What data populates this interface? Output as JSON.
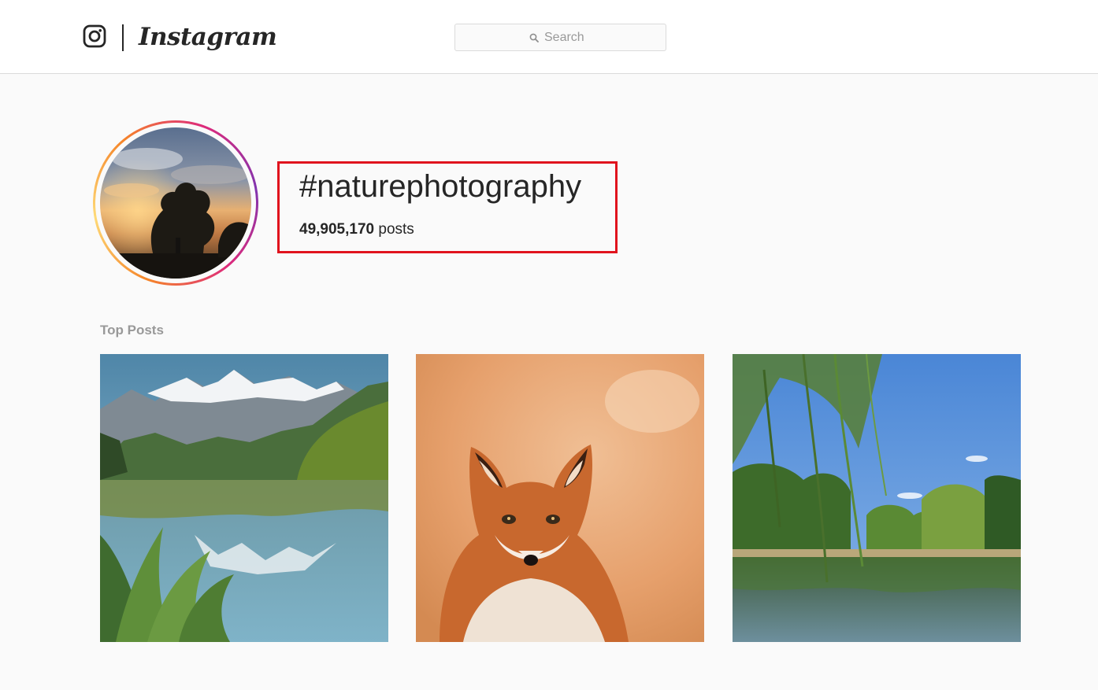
{
  "app": {
    "brand": "Instagram"
  },
  "header": {
    "logo_icon": "instagram-camera-icon",
    "search": {
      "placeholder": "Search",
      "icon": "search-icon"
    }
  },
  "hashtag": {
    "title": "#naturephotography",
    "post_count": "49,905,170",
    "post_count_suffix": " posts",
    "highlight_color": "#e0131d"
  },
  "sections": {
    "top_posts_label": "Top Posts"
  },
  "top_posts": [
    {
      "subject": "mountain-lake-reflection"
    },
    {
      "subject": "red-fox-portrait"
    },
    {
      "subject": "willow-tree-lake"
    }
  ],
  "colors": {
    "background": "#fafafa",
    "topbar": "#ffffff",
    "border": "#dbdbdb",
    "text": "#262626",
    "muted_text": "#999999"
  }
}
